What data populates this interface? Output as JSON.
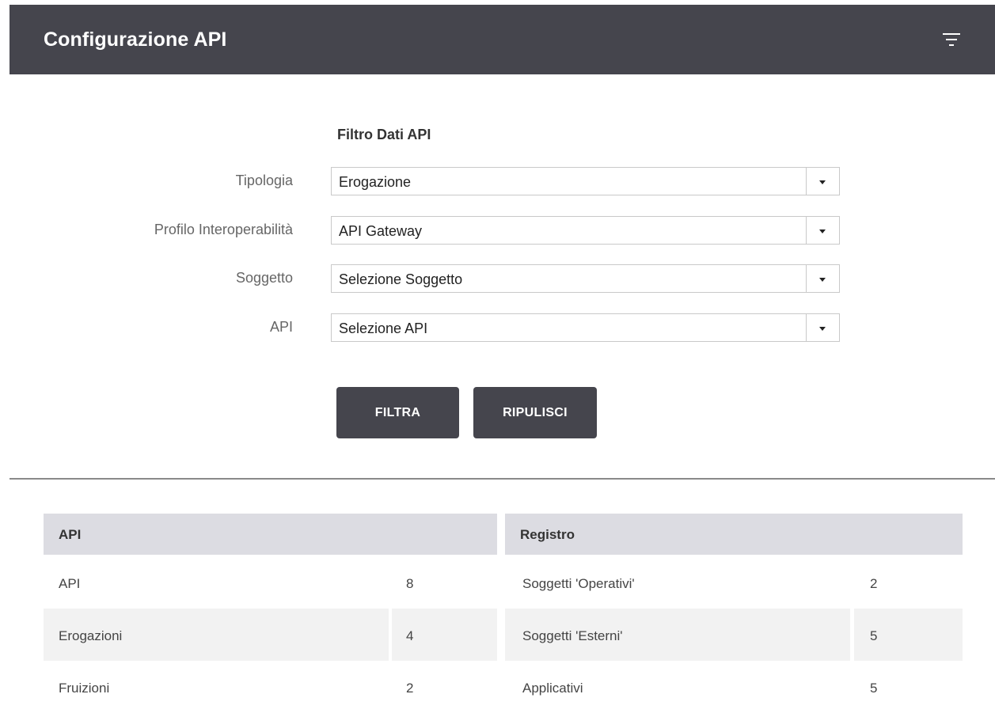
{
  "header": {
    "title": "Configurazione API"
  },
  "filter": {
    "title": "Filtro Dati API",
    "fields": [
      {
        "label": "Tipologia",
        "value": "Erogazione"
      },
      {
        "label": "Profilo Interoperabilità",
        "value": "API Gateway"
      },
      {
        "label": "Soggetto",
        "value": "Selezione Soggetto"
      },
      {
        "label": "API",
        "value": "Selezione API"
      }
    ],
    "buttons": {
      "filter": "FILTRA",
      "reset": "RIPULISCI"
    }
  },
  "stats": {
    "api": {
      "header": "API",
      "rows": [
        {
          "name": "API",
          "count": "8"
        },
        {
          "name": "Erogazioni",
          "count": "4"
        },
        {
          "name": "Fruizioni",
          "count": "2"
        }
      ]
    },
    "registro": {
      "header": "Registro",
      "rows": [
        {
          "name": "Soggetti 'Operativi'",
          "count": "2"
        },
        {
          "name": "Soggetti 'Esterni'",
          "count": "5"
        },
        {
          "name": "Applicativi",
          "count": "5"
        }
      ]
    }
  },
  "colors": {
    "header_bg": "#45454d",
    "table_header_bg": "#dcdce2",
    "row_shade": "#f2f2f2"
  }
}
